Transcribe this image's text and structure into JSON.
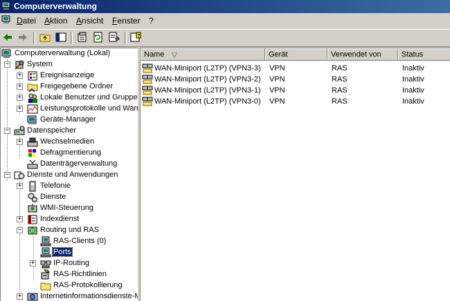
{
  "window": {
    "title": "Computerverwaltung"
  },
  "menu": {
    "items": [
      "Datei",
      "Aktion",
      "Ansicht",
      "Fenster",
      "?"
    ]
  },
  "tree": {
    "root": "Computerverwaltung (Lokal)",
    "system": "System",
    "ereignisanzeige": "Ereignisanzeige",
    "freigaben": "Freigegebene Ordner",
    "benutzer": "Lokale Benutzer und Gruppen",
    "leistung": "Leistungsprotokolle und Warnungen",
    "geraete": "Geräte-Manager",
    "datenspeicher": "Datenspeicher",
    "wechselmedien": "Wechselmedien",
    "defrag": "Defragmentierung",
    "datentraeger": "Datenträgerverwaltung",
    "dienste_anw": "Dienste und Anwendungen",
    "telefonie": "Telefonie",
    "dienste": "Dienste",
    "wmi": "WMI-Steuerung",
    "index": "Indexdienst",
    "routing": "Routing und RAS",
    "ras_clients": "RAS-Clients (0)",
    "ports": "Ports",
    "ip_routing": "IP-Routing",
    "ras_richtlinien": "RAS-Richtlinien",
    "ras_protokoll": "RAS-Protokollierung",
    "iis": "Internetinformationsdienste-Manager"
  },
  "list": {
    "columns": {
      "name": "Name",
      "geraet": "Gerät",
      "verwendet": "Verwendet von",
      "status": "Status"
    },
    "rows": [
      {
        "name": "WAN-Miniport (L2TP) (VPN3-3)",
        "geraet": "VPN",
        "verwendet": "RAS",
        "status": "Inaktiv"
      },
      {
        "name": "WAN-Miniport (L2TP) (VPN3-2)",
        "geraet": "VPN",
        "verwendet": "RAS",
        "status": "Inaktiv"
      },
      {
        "name": "WAN-Miniport (L2TP) (VPN3-1)",
        "geraet": "VPN",
        "verwendet": "RAS",
        "status": "Inaktiv"
      },
      {
        "name": "WAN-Miniport (L2TP) (VPN3-0)",
        "geraet": "VPN",
        "verwendet": "RAS",
        "status": "Inaktiv"
      }
    ]
  }
}
